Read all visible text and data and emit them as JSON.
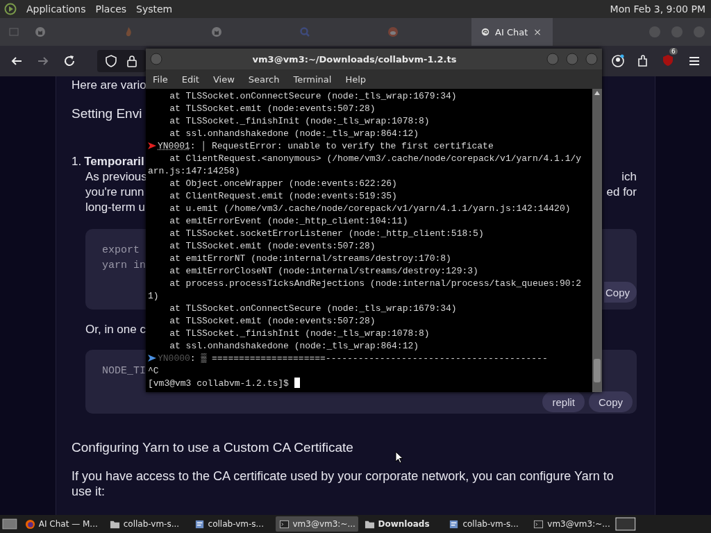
{
  "top_panel": {
    "menus": [
      "Applications",
      "Places",
      "System"
    ],
    "clock": "Mon Feb 3, 9:00 PM"
  },
  "browser": {
    "tabs": [
      {
        "kind": "cat",
        "selected": false
      },
      {
        "kind": "flame",
        "selected": false
      },
      {
        "kind": "cat",
        "selected": false
      },
      {
        "kind": "magnifier",
        "selected": false
      },
      {
        "kind": "robot",
        "selected": false
      },
      {
        "kind": "swirl",
        "label": "AI Chat",
        "close": "×",
        "selected": true
      }
    ],
    "forward_disabled": true,
    "extension_badge": "6"
  },
  "article": {
    "intro": "Here are vario",
    "section": "Setting Envi",
    "item_number": "1.",
    "item_title": "Temporaril",
    "para_rows": [
      {
        "left": "As previous",
        "right": "ich"
      },
      {
        "left": "you're runn",
        "right": "ed for"
      },
      {
        "left": "long-term u"
      }
    ],
    "code_block_1": {
      "lines": [
        "export",
        "yarn in"
      ],
      "buttons": [
        "Copy"
      ]
    },
    "or_text": "Or, in one c",
    "code_block_2": {
      "lines": [
        "NODE_TI"
      ],
      "buttons": [
        "replit",
        "Copy"
      ]
    },
    "heading": "Configuring Yarn to use a Custom CA Certificate",
    "paragraph": "If you have access to the CA certificate used by your corporate network, you can configure Yarn to use it:"
  },
  "terminal": {
    "title": "vm3@vm3:~/Downloads/collabvm-1.2.ts",
    "menu": [
      "File",
      "Edit",
      "View",
      "Search",
      "Terminal",
      "Help"
    ],
    "lines": [
      {
        "kind": "plain",
        "text": "    at TLSSocket.onConnectSecure (node:_tls_wrap:1679:34)"
      },
      {
        "kind": "plain",
        "text": "    at TLSSocket.emit (node:events:507:28)"
      },
      {
        "kind": "plain",
        "text": "    at TLSSocket._finishInit (node:_tls_wrap:1078:8)"
      },
      {
        "kind": "plain",
        "text": "    at ssl.onhandshakedone (node:_tls_wrap:864:12)"
      },
      {
        "kind": "error",
        "code": "YN0001",
        "text": ": │ RequestError: unable to verify the first certificate"
      },
      {
        "kind": "plain",
        "text": "    at ClientRequest.<anonymous> (/home/vm3/.cache/node/corepack/v1/yarn/4.1.1/y"
      },
      {
        "kind": "plain",
        "text": "arn.js:147:14258)"
      },
      {
        "kind": "plain",
        "text": "    at Object.onceWrapper (node:events:622:26)"
      },
      {
        "kind": "plain",
        "text": "    at ClientRequest.emit (node:events:519:35)"
      },
      {
        "kind": "plain",
        "text": "    at u.emit (/home/vm3/.cache/node/corepack/v1/yarn/4.1.1/yarn.js:142:14420)"
      },
      {
        "kind": "plain",
        "text": "    at emitErrorEvent (node:_http_client:104:11)"
      },
      {
        "kind": "plain",
        "text": "    at TLSSocket.socketErrorListener (node:_http_client:518:5)"
      },
      {
        "kind": "plain",
        "text": "    at TLSSocket.emit (node:events:507:28)"
      },
      {
        "kind": "plain",
        "text": "    at emitErrorNT (node:internal/streams/destroy:170:8)"
      },
      {
        "kind": "plain",
        "text": "    at emitErrorCloseNT (node:internal/streams/destroy:129:3)"
      },
      {
        "kind": "plain",
        "text": "    at process.processTicksAndRejections (node:internal/process/task_queues:90:2"
      },
      {
        "kind": "plain",
        "text": "1)"
      },
      {
        "kind": "plain",
        "text": "    at TLSSocket.onConnectSecure (node:_tls_wrap:1679:34)"
      },
      {
        "kind": "plain",
        "text": "    at TLSSocket.emit (node:events:507:28)"
      },
      {
        "kind": "plain",
        "text": "    at TLSSocket._finishInit (node:_tls_wrap:1078:8)"
      },
      {
        "kind": "plain",
        "text": "    at ssl.onhandshakedone (node:_tls_wrap:864:12)"
      },
      {
        "kind": "progress",
        "code": "YN0000",
        "text": ": ▒ =====================-----------------------------------------"
      },
      {
        "kind": "plain",
        "text": "^C"
      },
      {
        "kind": "prompt",
        "text": "[vm3@vm3 collabvm-1.2.ts]$ "
      }
    ]
  },
  "taskbar": {
    "items": [
      {
        "kind": "browser",
        "label": "AI Chat — M...",
        "pressed": false,
        "bold": false
      },
      {
        "kind": "folder",
        "label": "collab-vm-s...",
        "pressed": false,
        "bold": false
      },
      {
        "kind": "editor",
        "label": "collab-vm-s...",
        "pressed": false,
        "bold": false
      },
      {
        "kind": "terminal",
        "label": "vm3@vm3:~...",
        "pressed": true,
        "bold": false
      },
      {
        "kind": "folder",
        "label": "Downloads",
        "pressed": false,
        "bold": true
      },
      {
        "kind": "editor",
        "label": "collab-vm-s...",
        "pressed": false,
        "bold": false
      },
      {
        "kind": "terminal",
        "label": "vm3@vm3:~...",
        "pressed": false,
        "bold": false
      }
    ]
  }
}
